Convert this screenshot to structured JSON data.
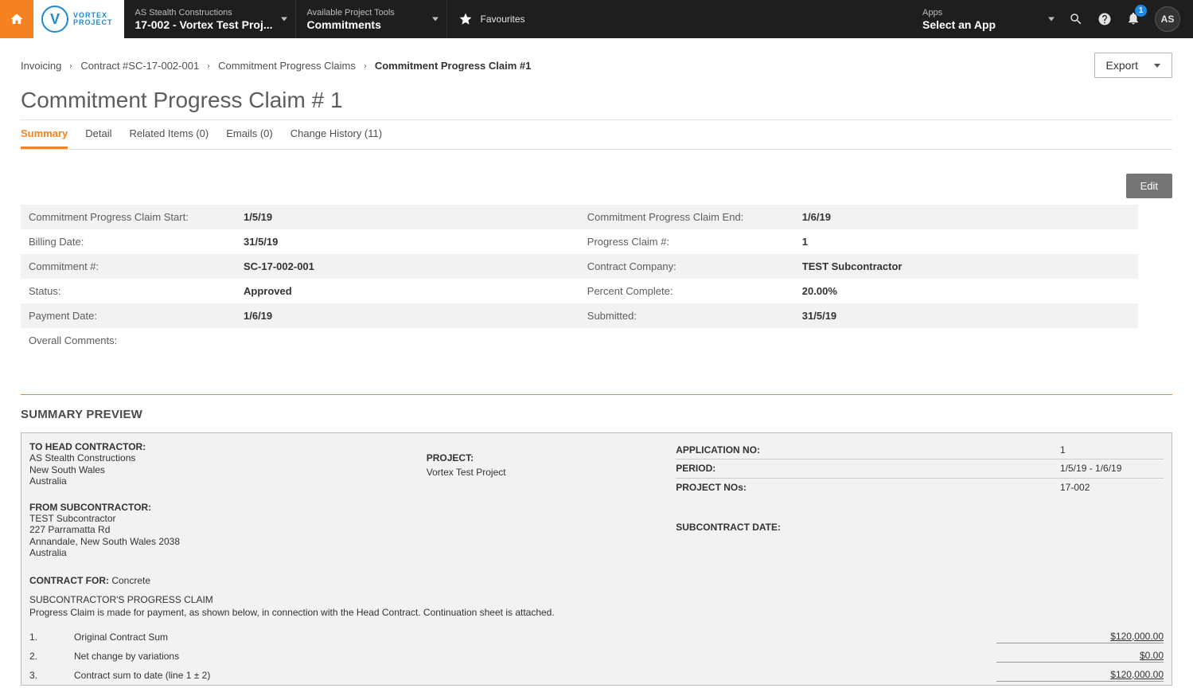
{
  "nav": {
    "project_dropdown": {
      "label": "AS Stealth Constructions",
      "value": "17-002 - Vortex Test Proj..."
    },
    "tools_dropdown": {
      "label": "Available Project Tools",
      "value": "Commitments"
    },
    "favourites": "Favourites",
    "apps_dropdown": {
      "label": "Apps",
      "value": "Select an App"
    },
    "notif_count": "1",
    "avatar_initials": "AS",
    "logo_text1": "VORTEX",
    "logo_text2": "PROJECT",
    "logo_letter": "V"
  },
  "breadcrumbs": {
    "crumb0": "Invoicing",
    "crumb1": "Contract #SC-17-002-001",
    "crumb2": "Commitment Progress Claims",
    "crumb3": "Commitment Progress Claim #1"
  },
  "export_label": "Export",
  "page_title": "Commitment Progress Claim # 1",
  "tabs": {
    "summary": "Summary",
    "detail": "Detail",
    "related": "Related Items (0)",
    "emails": "Emails (0)",
    "history": "Change History (11)"
  },
  "edit_label": "Edit",
  "summary": {
    "start_label": "Commitment Progress Claim Start:",
    "start_value": "1/5/19",
    "end_label": "Commitment Progress Claim End:",
    "end_value": "1/6/19",
    "billing_label": "Billing Date:",
    "billing_value": "31/5/19",
    "claimno_label": "Progress Claim #:",
    "claimno_value": "1",
    "commitno_label": "Commitment #:",
    "commitno_value": "SC-17-002-001",
    "company_label": "Contract Company:",
    "company_value": "TEST Subcontractor",
    "status_label": "Status:",
    "status_value": "Approved",
    "percent_label": "Percent Complete:",
    "percent_value": "20.00%",
    "paydate_label": "Payment Date:",
    "paydate_value": "1/6/19",
    "submitted_label": "Submitted:",
    "submitted_value": "31/5/19",
    "comments_label": "Overall Comments:",
    "comments_value": ""
  },
  "preview": {
    "heading": "SUMMARY PREVIEW",
    "head_contractor_label": "TO HEAD CONTRACTOR:",
    "head_contractor_line1": "AS Stealth Constructions",
    "head_contractor_line2": "New South Wales",
    "head_contractor_line3": "Australia",
    "subcontractor_label": "FROM SUBCONTRACTOR:",
    "subcontractor_line1": "TEST Subcontractor",
    "subcontractor_line2": "227 Parramatta Rd",
    "subcontractor_line3": "Annandale, New South Wales 2038",
    "subcontractor_line4": "Australia",
    "project_label": "PROJECT:",
    "project_value": "Vortex Test Project",
    "app_no_label": "APPLICATION NO:",
    "app_no_value": "1",
    "period_label": "PERIOD:",
    "period_value": "1/5/19 - 1/6/19",
    "projno_label": "PROJECT NOs:",
    "projno_value": "17-002",
    "subdate_label": "SUBCONTRACT DATE:",
    "contract_for_label": "CONTRACT FOR:",
    "contract_for_value": "Concrete",
    "claim_title": "SUBCONTRACTOR'S PROGRESS CLAIM",
    "claim_desc": "Progress Claim is made for payment, as shown below, in connection with the Head Contract. Continuation sheet is attached.",
    "line1_num": "1.",
    "line1_desc": "Original Contract Sum",
    "line1_amt": "$120,000.00",
    "line2_num": "2.",
    "line2_desc": "Net change by variations",
    "line2_amt": "$0.00",
    "line3_num": "3.",
    "line3_desc": "Contract sum to date (line 1 ± 2)",
    "line3_amt": "$120,000.00"
  }
}
